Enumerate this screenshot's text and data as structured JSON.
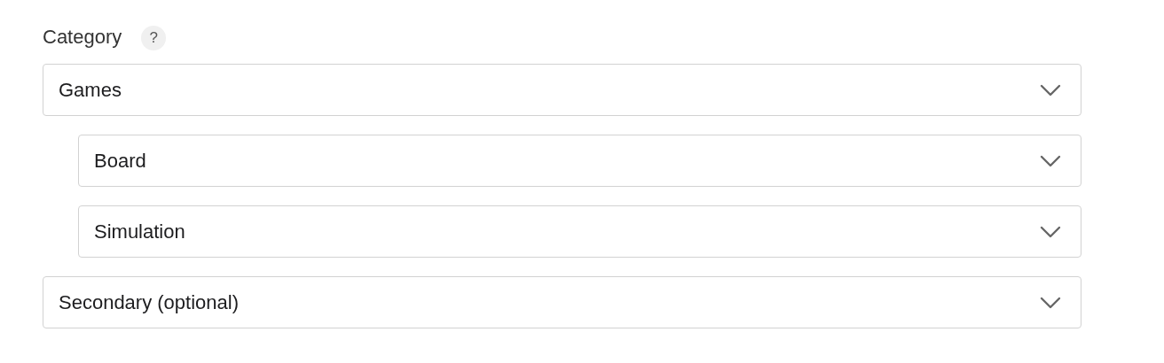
{
  "field": {
    "label": "Category",
    "help": "?",
    "primary": {
      "value": "Games",
      "children": [
        {
          "value": "Board"
        },
        {
          "value": "Simulation"
        }
      ]
    },
    "secondary": {
      "value": "Secondary (optional)"
    }
  }
}
